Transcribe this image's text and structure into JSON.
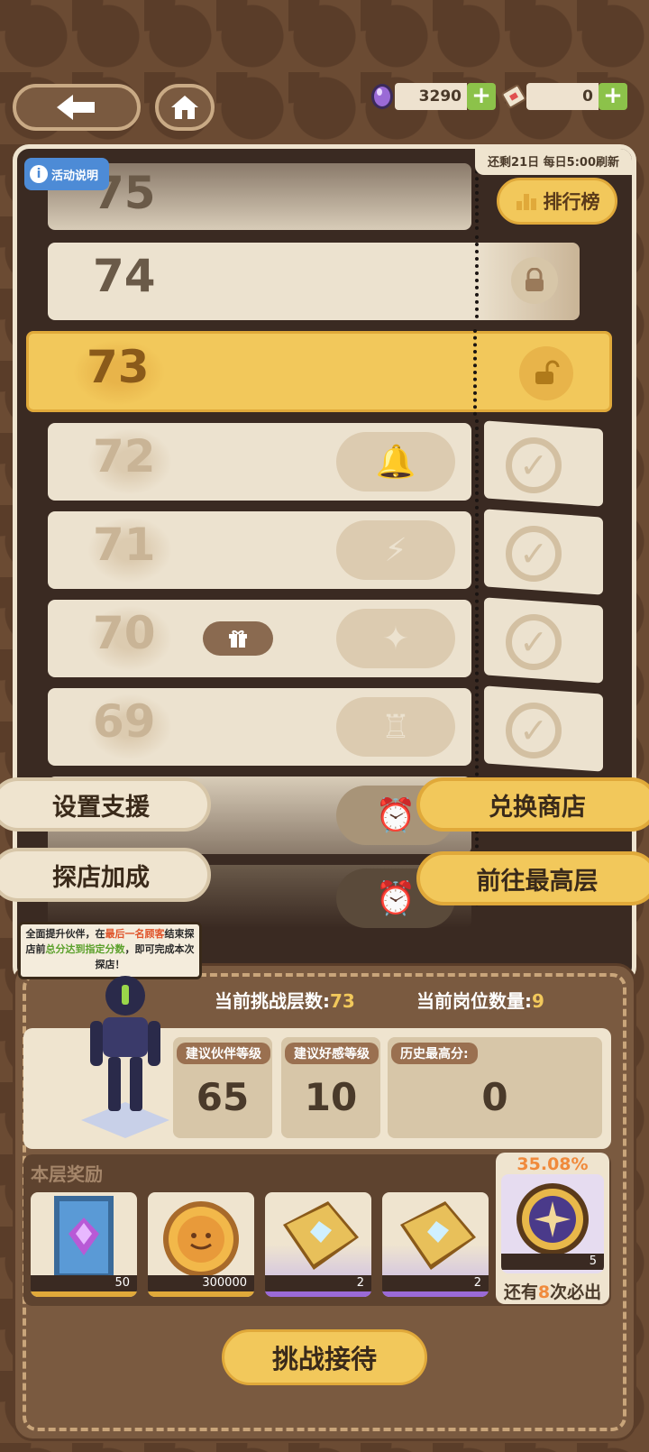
{
  "topbar": {
    "gem_value": "3290",
    "ticket_value": "0",
    "plus": "+"
  },
  "tower": {
    "refresh_text": "还剩21日 每日5:00刷新",
    "info_label": "活动说明",
    "info_icon": "i",
    "rank_label": "排行榜",
    "floors": [
      "75",
      "74",
      "73",
      "72",
      "71",
      "70",
      "69"
    ],
    "current_floor": "73"
  },
  "side_buttons": {
    "support": "设置支援",
    "bonus": "探店加成",
    "shop": "兑换商店",
    "go_top": "前往最高层"
  },
  "tip": {
    "part1": "全面提升伙伴，在",
    "highlight1": "最后一名顾客",
    "part2": "结束探店前",
    "highlight2": "总分达到指定分数",
    "part3": "，即可完成本次探店！"
  },
  "stats": {
    "floor_label": "当前挑战层数:",
    "floor_value": "73",
    "slots_label": "当前岗位数量:",
    "slots_value": "9"
  },
  "cards": [
    {
      "label": "建议伙伴等级",
      "value": "65"
    },
    {
      "label": "建议好感等级",
      "value": "10"
    },
    {
      "label": "历史最高分:",
      "value": "0"
    }
  ],
  "rewards": {
    "title": "本层奖励",
    "items": [
      {
        "name": "gem-card",
        "count": "50"
      },
      {
        "name": "coin",
        "count": "300000"
      },
      {
        "name": "gold-book",
        "count": "2"
      },
      {
        "name": "gold-book",
        "count": "2"
      }
    ]
  },
  "guarantee": {
    "percent": "35.08%",
    "count": "5",
    "text_pre": "还有",
    "text_num": "8",
    "text_post": "次必出"
  },
  "challenge_label": "挑战接待",
  "colors": {
    "gold": "#f2c85b",
    "green": "#8cc24a",
    "orange": "#f08a3c",
    "panel": "#efe4cf"
  }
}
